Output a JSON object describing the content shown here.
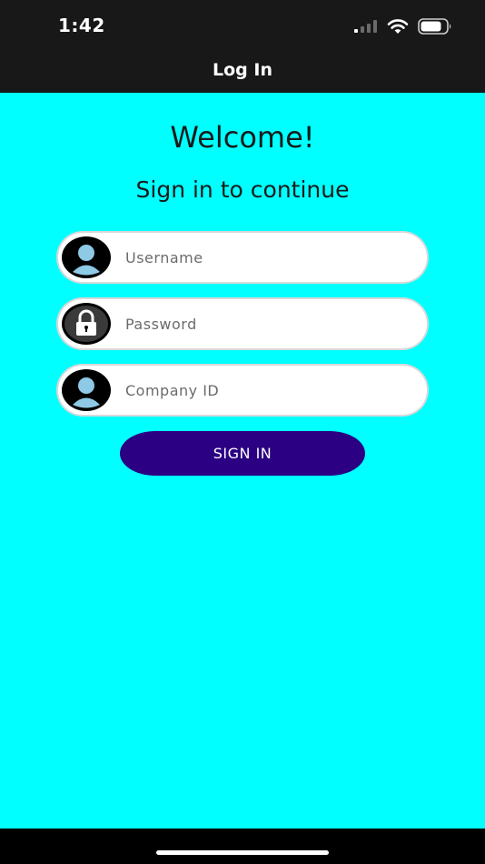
{
  "status_bar": {
    "time": "1:42",
    "icons": [
      "cellular-signal-icon",
      "wifi-icon",
      "battery-icon"
    ]
  },
  "nav": {
    "title": "Log In"
  },
  "header": {
    "welcome": "Welcome!",
    "subtitle": "Sign in to continue"
  },
  "form": {
    "username": {
      "placeholder": "Username",
      "value": "",
      "icon": "user-avatar-icon"
    },
    "password": {
      "placeholder": "Password",
      "value": "",
      "icon": "lock-icon"
    },
    "company_id": {
      "placeholder": "Company ID",
      "value": "",
      "icon": "user-avatar-icon"
    },
    "sign_in_label": "SIGN IN"
  },
  "colors": {
    "background": "#00FFFF",
    "top_bar": "#181818",
    "button": "#2B0082",
    "field": "#FFFFFF",
    "avatar_fill": "#8EC9E6"
  }
}
